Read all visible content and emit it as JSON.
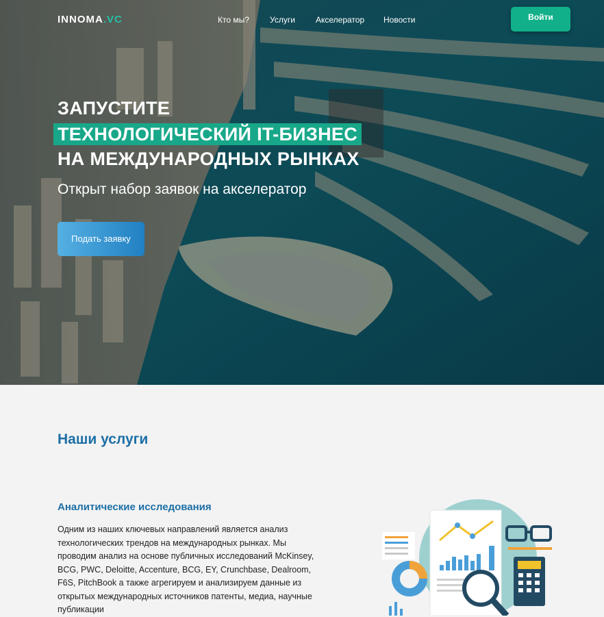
{
  "nav": {
    "logo_main": "INNOMA",
    "logo_accent": ".VC",
    "links": [
      "Кто мы?",
      "Услуги",
      "Акселератор",
      "Новости"
    ],
    "login_label": "Войти"
  },
  "hero": {
    "line1": "ЗАПУСТИТЕ",
    "line2": "ТЕХНОЛОГИЧЕСКИЙ IT-БИЗНЕС",
    "line3": "НА МЕЖДУНАРОДНЫХ РЫНКАХ",
    "subtitle": "Открыт набор заявок на акселератор",
    "cta_label": "Подать заявку"
  },
  "services": {
    "title": "Наши услуги",
    "item_title": "Аналитические исследования",
    "item_text": "Одним из наших ключевых направлений является анализ технологических трендов на международных рынках. Мы проводим анализ на основе публичных исследований McKinsey, BCG, PWC, Deloitte, Accenture, BCG, EY, Crunchbase, Dealroom, F6S, PitchBook а также агрегируем и анализируем данные из открытых международных источников патенты, медиа, научные публикации"
  },
  "colors": {
    "accent_green": "#18a889",
    "brand_blue": "#1c6fa6"
  }
}
